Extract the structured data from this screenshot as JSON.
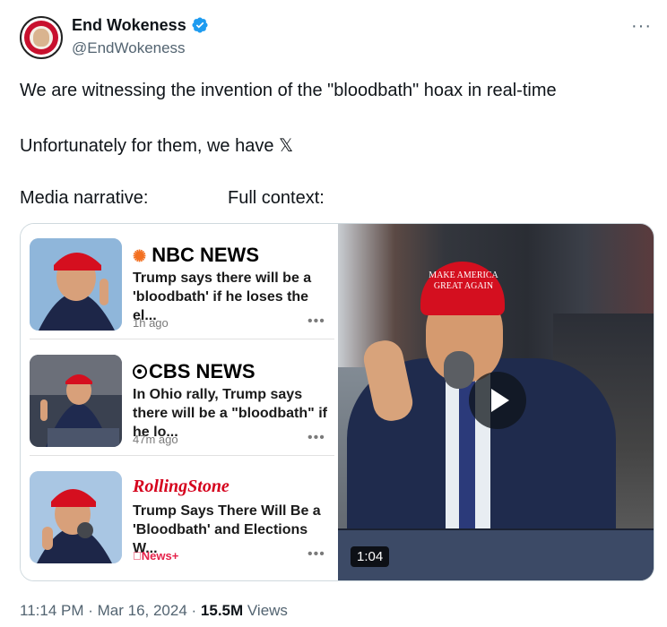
{
  "header": {
    "display_name": "End Wokeness",
    "handle": "@EndWokeness",
    "more_label": "···"
  },
  "tweet": {
    "line1": "We are witnessing the invention of the \"bloodbath\" hoax in real-time",
    "line2": "Unfortunately for them, we have 𝕏",
    "line3_left": "Media narrative:",
    "line3_right": "Full context:"
  },
  "news_cards": [
    {
      "brand": "NBC NEWS",
      "headline": "Trump says there will be a 'bloodbath' if he loses the el...",
      "time": "1h ago",
      "dots": "•••"
    },
    {
      "brand": "CBS NEWS",
      "headline": "In Ohio rally, Trump says there will be a \"bloodbath\" if he lo...",
      "time": "47m ago",
      "dots": "•••"
    },
    {
      "brand": "RollingStone",
      "headline": "Trump Says There Will Be a 'Bloodbath' and Elections W...",
      "time": "News+",
      "dots": "•••"
    }
  ],
  "video": {
    "cap_text": "MAKE AMERICA GREAT AGAIN",
    "duration": "1:04"
  },
  "footer": {
    "time_date": "11:14 PM · Mar 16, 2024 · ",
    "views_count": "15.5M",
    "views_label": " Views"
  },
  "colors": {
    "verified": "#1d9bf0",
    "secondary_text": "#536471",
    "rollingstone": "#d5001c",
    "applenews": "#e5224a"
  }
}
